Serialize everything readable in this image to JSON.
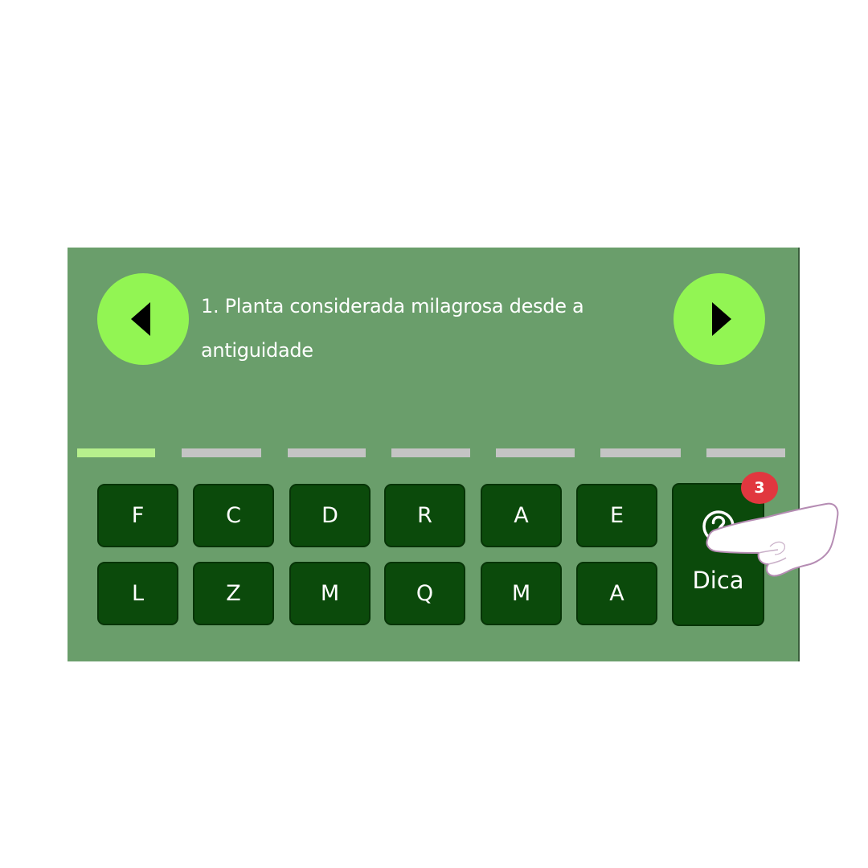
{
  "clue": {
    "text": "1. Planta considerada milagrosa desde a antiguidade"
  },
  "navigation": {
    "prev_icon": "triangle-left-icon",
    "next_icon": "triangle-right-icon"
  },
  "answer": {
    "total_slots": 7,
    "active_slot": 0
  },
  "keyboard": {
    "row1": [
      "F",
      "C",
      "D",
      "R",
      "A",
      "E"
    ],
    "row2": [
      "L",
      "Z",
      "M",
      "Q",
      "M",
      "A"
    ]
  },
  "hint": {
    "label": "Dica",
    "icon": "question-circle-icon",
    "remaining": "3"
  },
  "colors": {
    "panel": "#6a9e6b",
    "nav_button": "#92f553",
    "key": "#0b4a0b",
    "slot": "#c4c4c4",
    "slot_active": "#b7f08d",
    "badge": "#e1373f"
  },
  "pointer": {
    "icon": "hand-pointer-icon"
  }
}
